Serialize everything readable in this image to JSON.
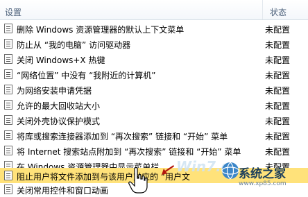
{
  "header": {
    "setting_label": "设置",
    "state_label": "状态"
  },
  "rows": [
    {
      "label": "删除 Windows 资源管理器的默认上下文菜单",
      "state": "未配置"
    },
    {
      "label": "防止从 “我的电脑” 访问驱动器",
      "state": "未配置"
    },
    {
      "label": "关闭 Windows+X 热键",
      "state": "未配置"
    },
    {
      "label": "“网络位置” 中没有 “我附近的计算机”",
      "state": "未配置"
    },
    {
      "label": "为网络安装申请凭据",
      "state": "未配置"
    },
    {
      "label": "允许的最大回收站大小",
      "state": "未配置"
    },
    {
      "label": "关闭外壳协议保护模式",
      "state": "未配置"
    },
    {
      "label": "将库或搜索连接器添加到 “再次搜索” 链接和 “开始” 菜单",
      "state": "未配置"
    },
    {
      "label": "将 Internet 搜索站点附加到 “再次搜索” 链接和 “开始” 菜单",
      "state": "未配置"
    },
    {
      "label": "在 Windows 资源管理器中显示菜单栏",
      "state": "未配置"
    },
    {
      "label": "阻止用户将文件添加到与该用户对应的 “用户文",
      "state": "",
      "selected": true
    },
    {
      "label": "关闭常用控件和窗口动画",
      "state": ""
    }
  ],
  "watermark": {
    "brand": "Win7.ω",
    "site": "系统之家",
    "sub": "www.xp85.com"
  },
  "colors": {
    "selection": "#ffe27a",
    "header_text": "#4c607a",
    "arrow": "#b3160d"
  }
}
